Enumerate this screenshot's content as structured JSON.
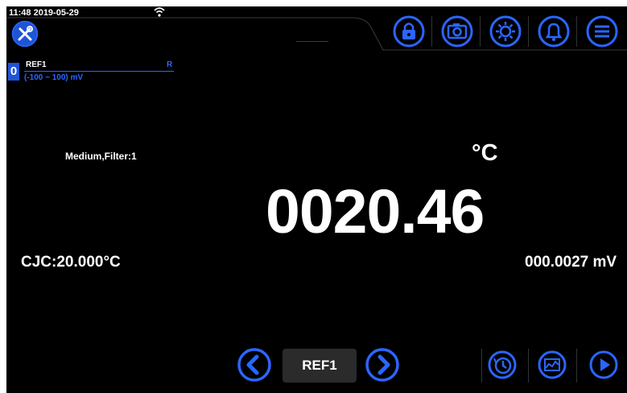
{
  "status_bar": {
    "datetime": "11:48 2019-05-29"
  },
  "icons": {
    "wifi": "wifi-icon",
    "tools": "tools-icon",
    "lock": "lock-icon",
    "camera": "camera-icon",
    "brightness": "brightness-icon",
    "alarm": "alarm-bell-icon",
    "menu": "menu-icon",
    "prev": "chevron-left-icon",
    "next": "chevron-right-icon",
    "history": "history-icon",
    "trend": "trend-chart-icon",
    "play": "play-icon"
  },
  "channel": {
    "number": "0",
    "name": "REF1",
    "flag": "R",
    "range": "(-100 ~ 100) mV"
  },
  "measurement": {
    "filter": "Medium,Filter:1",
    "unit": "°C",
    "reading": "0020.46",
    "cjc": "CJC:20.000°C",
    "raw": "000.0027 mV"
  },
  "bottom": {
    "channel_select": "REF1"
  },
  "colors": {
    "accent": "#2a66ff",
    "background": "#000000",
    "panel": "#2b2b2b"
  }
}
